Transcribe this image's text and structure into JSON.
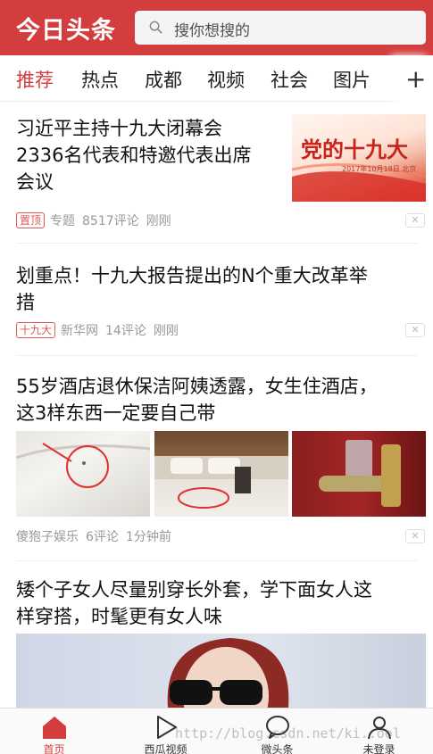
{
  "header": {
    "logo": "今日头条",
    "search_placeholder": "搜你想搜的"
  },
  "channels": [
    "推荐",
    "热点",
    "成都",
    "视频",
    "社会",
    "图片",
    "+"
  ],
  "articles": [
    {
      "title_lines": [
        "习近平主持十九大闭幕会",
        "2336名代表和特邀代表出席",
        "会议"
      ],
      "tag": "置顶",
      "source": "专题",
      "comments": "8517评论",
      "time": "刚刚",
      "thumb_text": "党的十九大",
      "thumb_caption": "2017年10月18日 北京"
    },
    {
      "title_lines": [
        "划重点！十九大报告提出的N个重大改革举",
        "措"
      ],
      "tag": "十九大",
      "source": "新华网",
      "comments": "14评论",
      "time": "刚刚"
    },
    {
      "title_lines": [
        "55岁酒店退休保洁阿姨透露，女生住酒店，",
        "这3样东西一定要自己带"
      ],
      "source": "傻狍子娱乐",
      "comments": "6评论",
      "time": "1分钟前"
    },
    {
      "title_lines": [
        "矮个子女人尽量别穿长外套，学下面女人这",
        "样穿搭，时髦更有女人味"
      ]
    }
  ],
  "dismiss_label": "✕",
  "bottom_nav": [
    {
      "label": "首页",
      "icon": "home-icon"
    },
    {
      "label": "西瓜视频",
      "icon": "play-icon"
    },
    {
      "label": "微头条",
      "icon": "chat-bubble-icon"
    },
    {
      "label": "未登录",
      "icon": "user-icon"
    }
  ],
  "watermark": "http://blog.csdn.net/ki..ool",
  "colors": {
    "brand": "#d43d3d",
    "tag": "#e05555"
  }
}
